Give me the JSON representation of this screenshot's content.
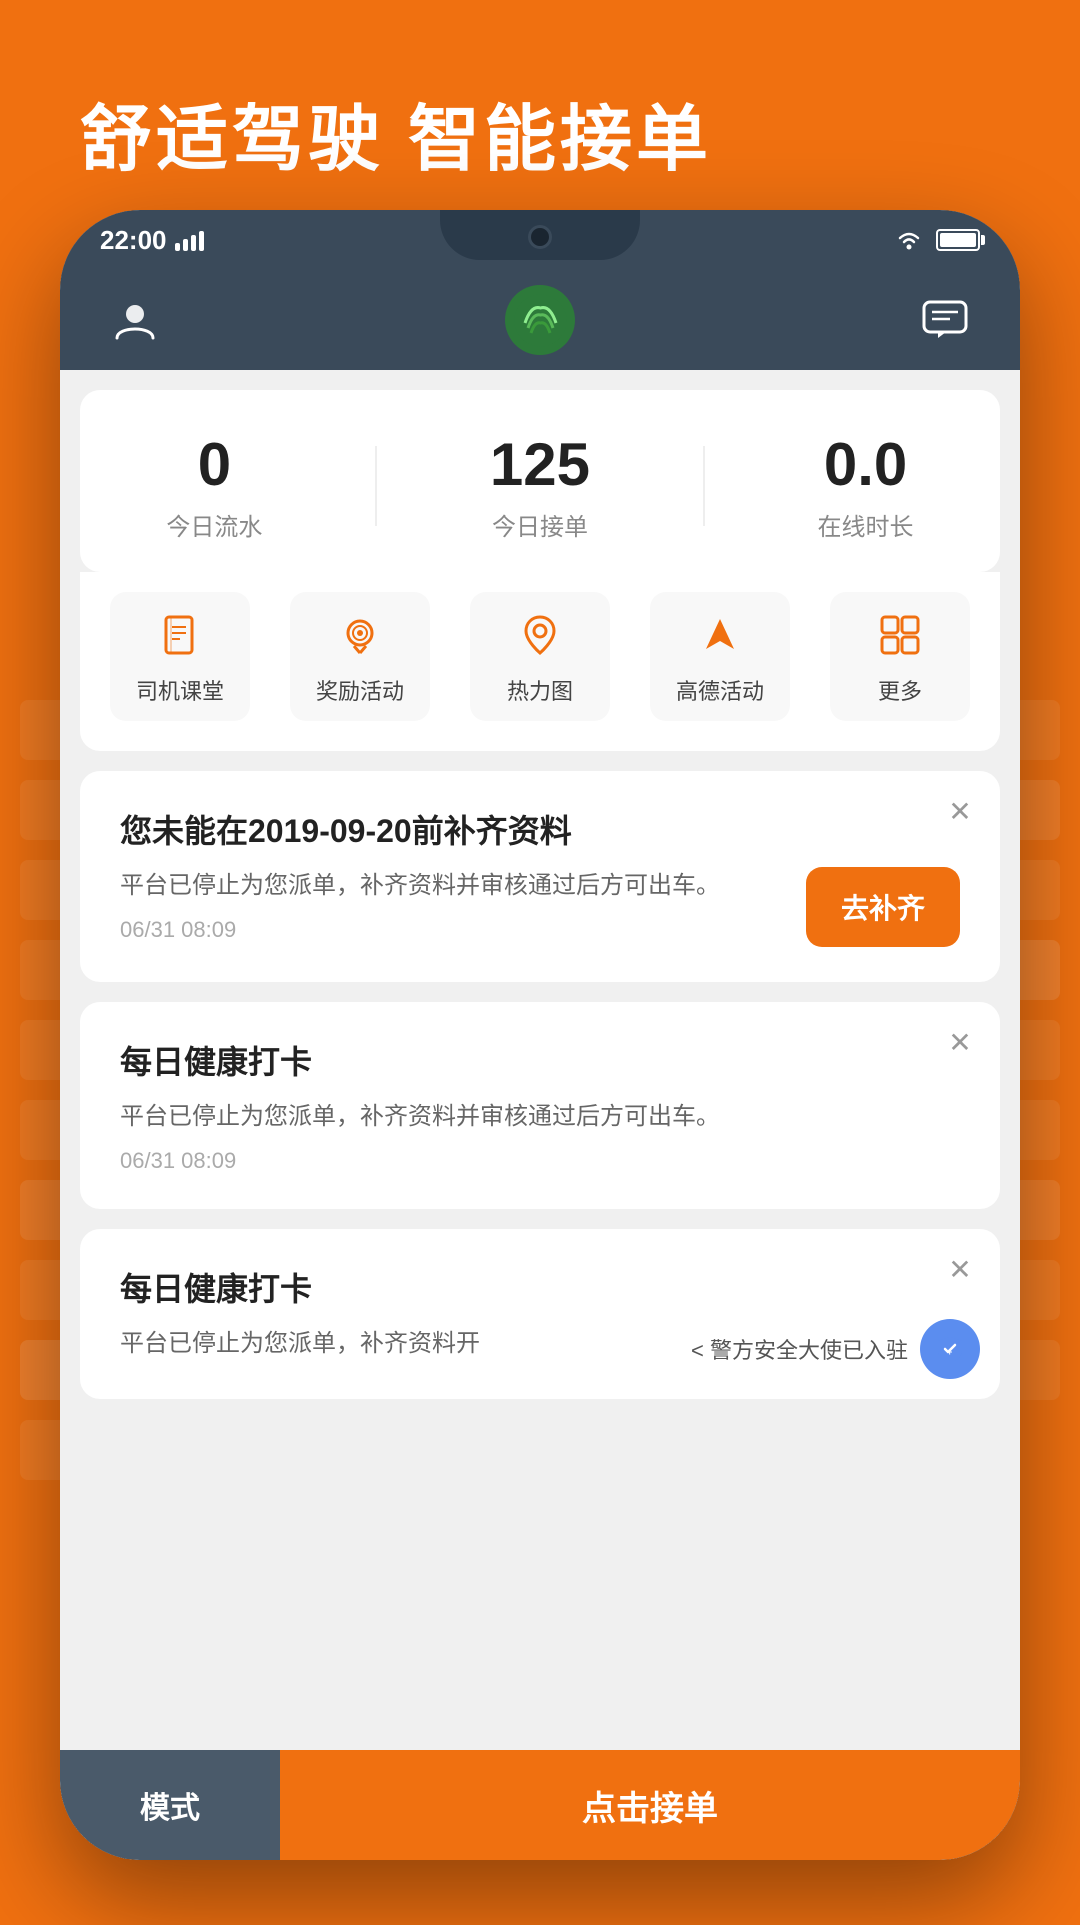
{
  "background": {
    "color": "#F07010"
  },
  "hero": {
    "text": "舒适驾驶  智能接单"
  },
  "status_bar": {
    "time": "22:00",
    "signal": "signal",
    "wifi": "wifi",
    "battery": "battery"
  },
  "header": {
    "user_icon": "user",
    "logo_alt": "app-logo",
    "message_icon": "message"
  },
  "stats": [
    {
      "value": "0",
      "label": "今日流水"
    },
    {
      "value": "125",
      "label": "今日接单"
    },
    {
      "value": "0.0",
      "label": "在线时长"
    }
  ],
  "quick_menu": [
    {
      "label": "司机课堂",
      "icon": "book"
    },
    {
      "label": "奖励活动",
      "icon": "award"
    },
    {
      "label": "热力图",
      "icon": "location"
    },
    {
      "label": "高德活动",
      "icon": "navigation"
    },
    {
      "label": "更多",
      "icon": "grid"
    }
  ],
  "cards": [
    {
      "id": "card1",
      "title": "您未能在2019-09-20前补齐资料",
      "text": "平台已停止为您派单，补齐资料并审核通过后方可出车。",
      "time": "06/31 08:09",
      "action_label": "去补齐",
      "has_action": true
    },
    {
      "id": "card2",
      "title": "每日健康打卡",
      "text": "平台已停止为您派单，补齐资料并审核通过后方可出车。",
      "time": "06/31 08:09",
      "has_action": false
    },
    {
      "id": "card3",
      "title": "每日健康打卡",
      "text": "平台已停止为您派单，补齐资料开",
      "has_action": false,
      "police_text": "< 警方安全大使已入驻"
    }
  ],
  "bottom_bar": {
    "mode_label": "模式",
    "accept_label": "点击接单"
  }
}
